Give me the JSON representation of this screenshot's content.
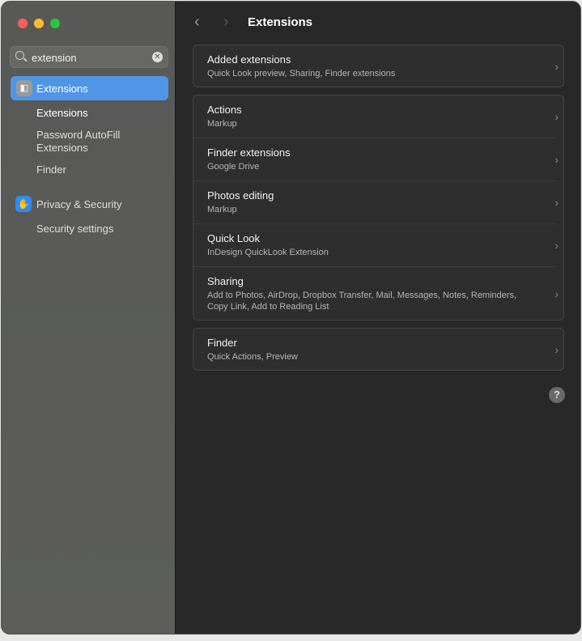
{
  "search": {
    "value": "extension"
  },
  "sidebar": {
    "selected": "Extensions",
    "subitems": [
      "Extensions",
      "Password AutoFill Extensions",
      "Finder"
    ],
    "privacy": "Privacy & Security",
    "privacy_sub": "Security settings"
  },
  "header": {
    "title": "Extensions"
  },
  "groups": [
    [
      {
        "title": "Added extensions",
        "subtitle": "Quick Look preview, Sharing, Finder extensions"
      }
    ],
    [
      {
        "title": "Actions",
        "subtitle": "Markup"
      },
      {
        "title": "Finder extensions",
        "subtitle": "Google Drive"
      },
      {
        "title": "Photos editing",
        "subtitle": "Markup"
      },
      {
        "title": "Quick Look",
        "subtitle": "InDesign QuickLook Extension"
      },
      {
        "title": "Sharing",
        "subtitle": "Add to Photos, AirDrop, Dropbox Transfer, Mail, Messages, Notes, Reminders, Copy Link, Add to Reading List"
      }
    ],
    [
      {
        "title": "Finder",
        "subtitle": "Quick Actions, Preview"
      }
    ]
  ],
  "help": "?"
}
